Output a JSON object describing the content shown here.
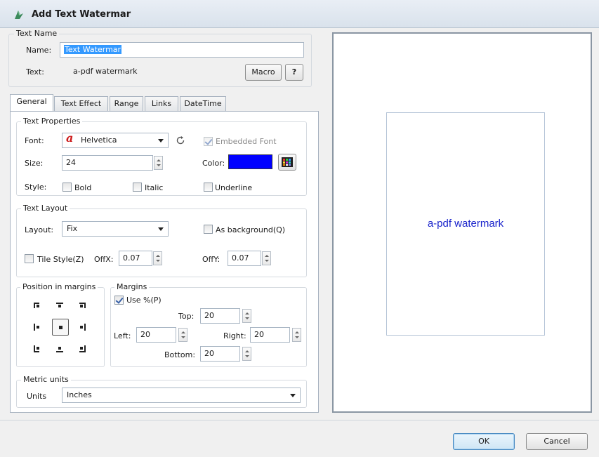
{
  "dialog": {
    "title": "Add Text Watermar"
  },
  "text_name": {
    "group_label": "Text Name",
    "name_label": "Name:",
    "name_value": "Text Watermar",
    "text_label": "Text:",
    "text_value": "a-pdf watermark",
    "macro_label": "Macro",
    "help_label": "?"
  },
  "tabs": [
    {
      "label": "General"
    },
    {
      "label": "Text Effect"
    },
    {
      "label": "Range"
    },
    {
      "label": "Links"
    },
    {
      "label": "DateTime"
    }
  ],
  "text_properties": {
    "group_label": "Text Properties",
    "font_label": "Font:",
    "font_value": "Helvetica",
    "embedded_font_label": "Embedded Font",
    "size_label": "Size:",
    "size_value": "24",
    "color_label": "Color:",
    "color_value": "#0000ff",
    "style_label": "Style:",
    "bold_label": "Bold",
    "italic_label": "Italic",
    "underline_label": "Underline"
  },
  "text_layout": {
    "group_label": "Text Layout",
    "layout_label": "Layout:",
    "layout_value": "Fix",
    "as_background_label": "As background(Q)",
    "tile_style_label": "Tile Style(Z)",
    "offx_label": "OffX:",
    "offx_value": "0.07",
    "offy_label": "OffY:",
    "offy_value": "0.07"
  },
  "position": {
    "group_label": "Position in margins",
    "selected": "center"
  },
  "margins": {
    "group_label": "Margins",
    "use_percent_label": "Use %(P)",
    "top_label": "Top:",
    "top_value": "20",
    "left_label": "Left:",
    "left_value": "20",
    "right_label": "Right:",
    "right_value": "20",
    "bottom_label": "Bottom:",
    "bottom_value": "20"
  },
  "metric_units": {
    "group_label": "Metric units",
    "units_label": "Units",
    "units_value": "Inches"
  },
  "preview": {
    "text": "a-pdf watermark",
    "text_color": "#1a24cc"
  },
  "footer": {
    "ok_label": "OK",
    "cancel_label": "Cancel"
  }
}
